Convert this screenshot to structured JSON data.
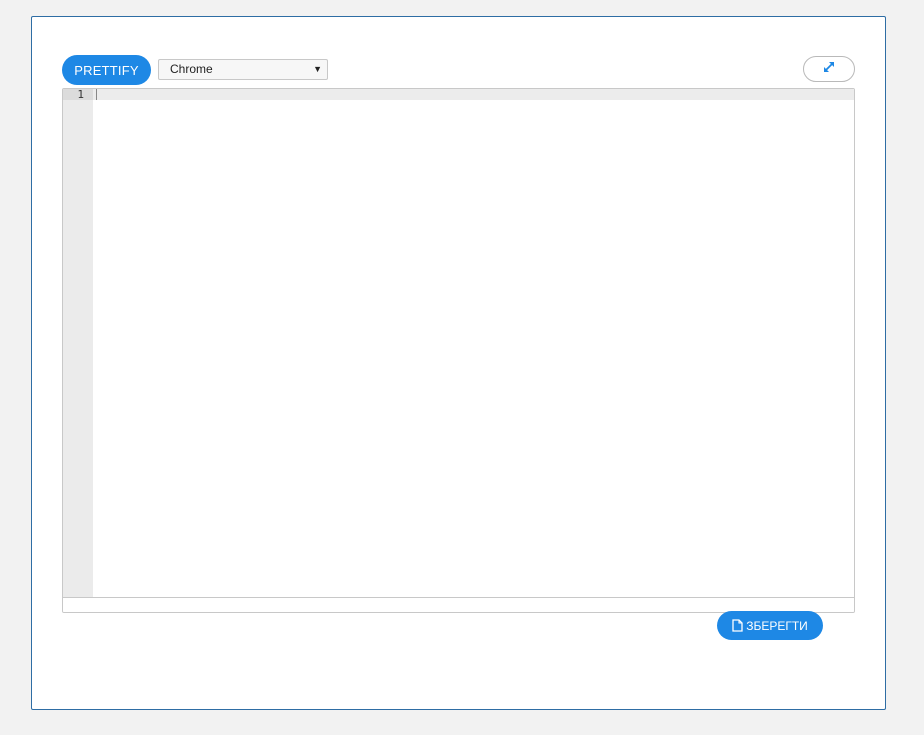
{
  "toolbar": {
    "prettify_label": "PRETTIFY",
    "theme_selected": "Chrome",
    "fullscreen_icon": "expand-arrows-icon"
  },
  "editor": {
    "line_numbers": [
      "1"
    ],
    "content": ""
  },
  "footer": {
    "save_label": "ЗБЕРЕГТИ",
    "save_icon": "file-icon"
  },
  "colors": {
    "accent": "#1e88e5",
    "panel_border": "#2e6da4",
    "page_background": "#f2f2f2"
  }
}
